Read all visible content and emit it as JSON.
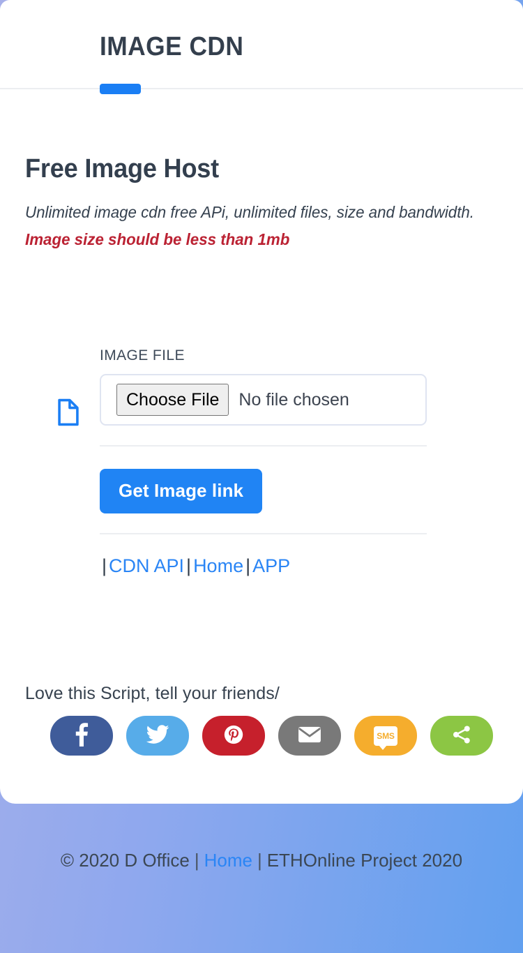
{
  "header": {
    "title": "IMAGE CDN",
    "accent_color": "#1a7ef4"
  },
  "intro": {
    "title": "Free Image Host",
    "subtitle": "Unlimited image cdn free APi, unlimited files, size and bandwidth.",
    "warning": "Image size should be less than 1mb",
    "warning_color": "#bb2233"
  },
  "form": {
    "file_label": "IMAGE FILE",
    "choose_file_label": "Choose File",
    "no_file_text": "No file chosen",
    "submit_label": "Get Image link",
    "submit_color": "#2084f4"
  },
  "links": {
    "lead_sep": "|",
    "sep": "|",
    "cdn_api": "CDN API",
    "home": "Home",
    "app": "APP",
    "link_color": "#2a85f5"
  },
  "share": {
    "title": "Love this Script, tell your friends/",
    "buttons": [
      {
        "name": "facebook",
        "label": "f",
        "color": "#3f5c9a"
      },
      {
        "name": "twitter",
        "label": "twitter-bird",
        "color": "#57ace9"
      },
      {
        "name": "pinterest",
        "label": "pinterest-p",
        "color": "#c6202c"
      },
      {
        "name": "email",
        "label": "envelope",
        "color": "#797979"
      },
      {
        "name": "sms",
        "label": "SMS",
        "color": "#f5ad2d"
      },
      {
        "name": "share",
        "label": "share-nodes",
        "color": "#8cc644"
      }
    ]
  },
  "footer": {
    "copyright": "© 2020 D Office",
    "sep": "|",
    "home": "Home",
    "project": "ETHOnline Project 2020",
    "gradient_from": "#a7b0e9",
    "gradient_to": "#62a0ef"
  }
}
